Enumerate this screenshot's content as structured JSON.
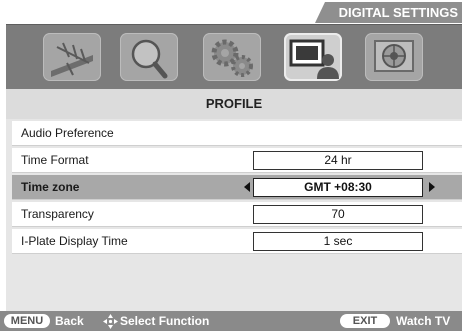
{
  "header": {
    "tab_label": "DIGITAL SETTINGS"
  },
  "icons": [
    {
      "name": "antenna-setup-icon",
      "active": false
    },
    {
      "name": "search-magnifier-icon",
      "active": false
    },
    {
      "name": "gears-icon",
      "active": false
    },
    {
      "name": "profile-monitor-person-icon",
      "active": true
    },
    {
      "name": "diagnostics-icon",
      "active": false
    }
  ],
  "menu": {
    "title": "PROFILE",
    "rows": [
      {
        "label": "Audio Preference",
        "value": null,
        "selected": false
      },
      {
        "label": "Time Format",
        "value": "24 hr",
        "selected": false
      },
      {
        "label": "Time zone",
        "value": "GMT +08:30",
        "selected": true
      },
      {
        "label": "Transparency",
        "value": "70",
        "selected": false
      },
      {
        "label": "I-Plate Display Time",
        "value": "1 sec",
        "selected": false
      }
    ]
  },
  "footer": {
    "menu_key": "MENU",
    "back_label": "Back",
    "select_label": "Select Function",
    "exit_key": "EXIT",
    "watch_label": "Watch TV"
  }
}
